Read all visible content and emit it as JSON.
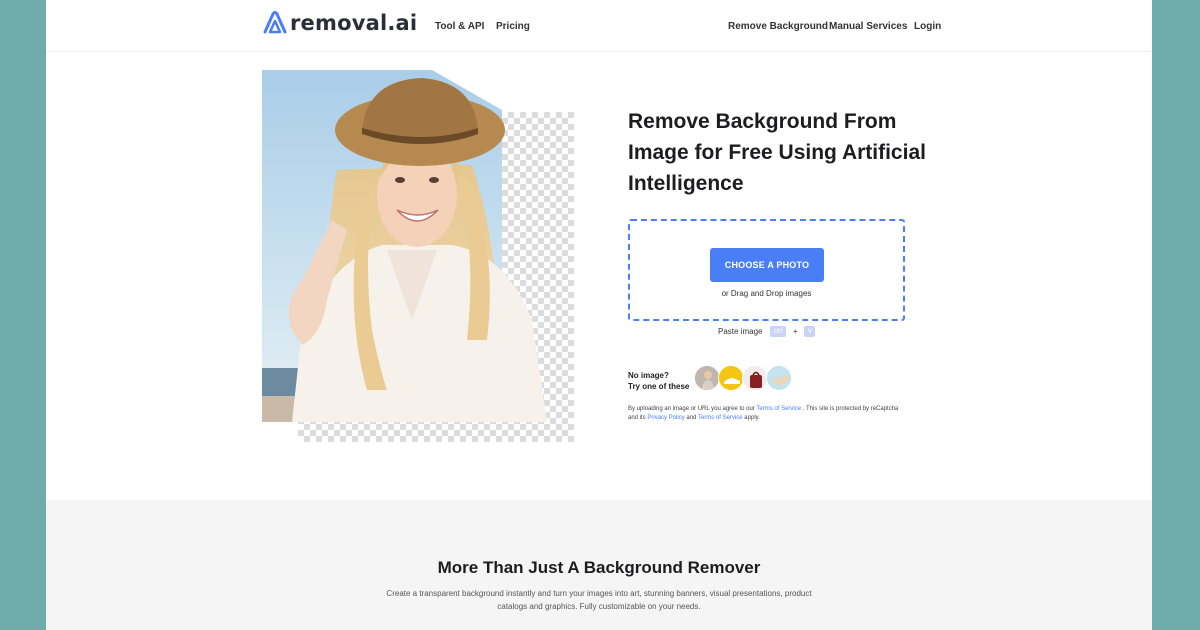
{
  "header": {
    "logo_text": "removal.ai",
    "nav_left": [
      "Tool & API",
      "Pricing"
    ],
    "nav_right": [
      "Remove Background",
      "Manual Services",
      "Login"
    ]
  },
  "hero": {
    "headline": "Remove Background From Image for Free Using Artificial Intelligence",
    "choose_button": "CHOOSE A PHOTO",
    "drag_text": "or Drag and Drop images",
    "paste_label": "Paste image",
    "paste_key_ctrl": "ctrl",
    "paste_plus": "+",
    "paste_key_v": "V",
    "no_image_line1": "No image?",
    "no_image_line2": "Try one of these",
    "terms": {
      "part1": "By uploading an image or URL you agree to our ",
      "tos1": "Terms of Service",
      "part2": " . This site is protected by reCaptcha and its ",
      "privacy": "Privacy Policy",
      "part3": " and ",
      "tos2": "Terms of Service",
      "part4": " apply."
    }
  },
  "lower": {
    "title": "More Than Just A Background Remover",
    "description": "Create a transparent background instantly and turn your images into art, stunning banners, visual presentations, product catalogs and graphics. Fully customizable on your needs."
  },
  "colors": {
    "accent": "#4a7ef6",
    "frame": "#6fadad"
  },
  "icons": [
    "removal-logo-icon"
  ]
}
